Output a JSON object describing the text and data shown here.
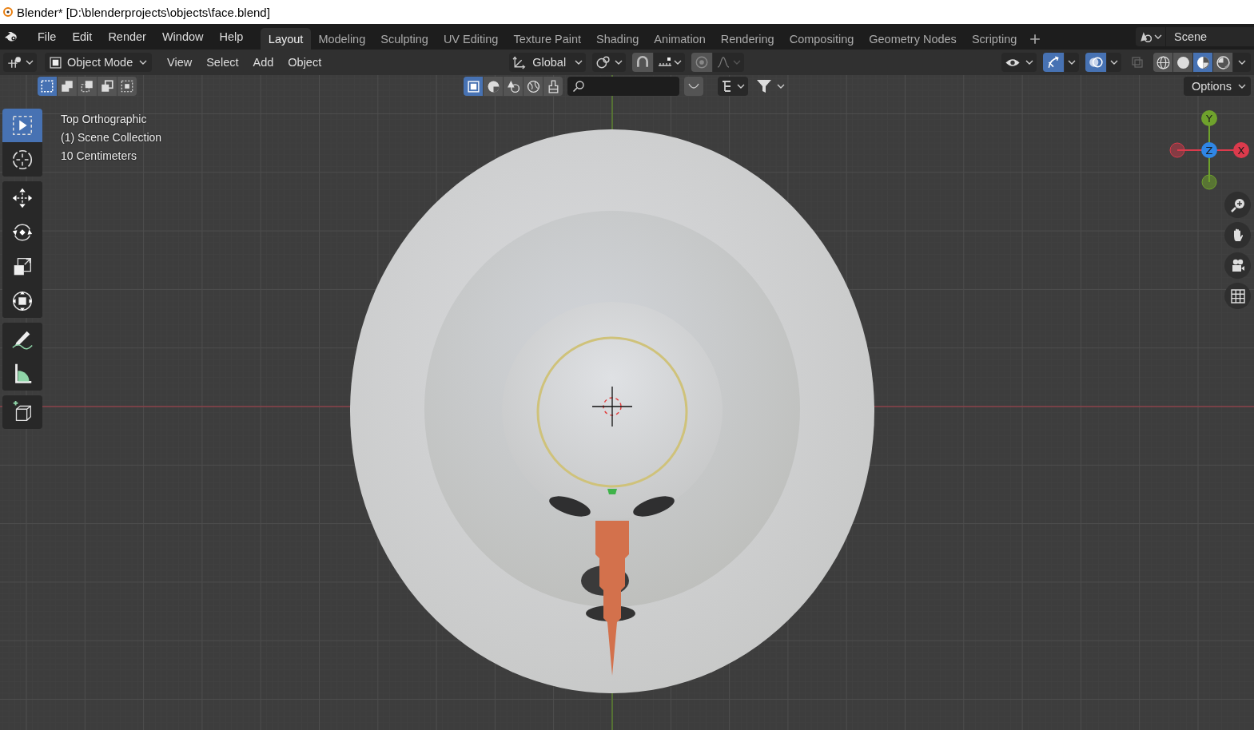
{
  "window": {
    "title": "Blender* [D:\\blenderprojects\\objects\\face.blend]"
  },
  "menu": [
    "File",
    "Edit",
    "Render",
    "Window",
    "Help"
  ],
  "workspaces": [
    {
      "label": "Layout",
      "selected": true
    },
    {
      "label": "Modeling",
      "selected": false
    },
    {
      "label": "Sculpting",
      "selected": false
    },
    {
      "label": "UV Editing",
      "selected": false
    },
    {
      "label": "Texture Paint",
      "selected": false
    },
    {
      "label": "Shading",
      "selected": false
    },
    {
      "label": "Animation",
      "selected": false
    },
    {
      "label": "Rendering",
      "selected": false
    },
    {
      "label": "Compositing",
      "selected": false
    },
    {
      "label": "Geometry Nodes",
      "selected": false
    },
    {
      "label": "Scripting",
      "selected": false
    }
  ],
  "scene": {
    "label": "Scene"
  },
  "header": {
    "mode": "Object Mode",
    "menus": [
      "View",
      "Select",
      "Add",
      "Object"
    ],
    "orientation": "Global"
  },
  "snap": {
    "on": false
  },
  "proportional_editing": {
    "on": false
  },
  "gizmos": {
    "on": true
  },
  "overlays": {
    "on": true
  },
  "xray": {
    "on": false
  },
  "shading_modes": [
    {
      "kind": "wireframe",
      "selected": false
    },
    {
      "kind": "solid",
      "selected": false
    },
    {
      "kind": "material",
      "selected": true
    },
    {
      "kind": "rendered",
      "selected": false
    }
  ],
  "select_modes": [
    {
      "kind": "set",
      "selected": true
    },
    {
      "kind": "extend",
      "selected": false
    },
    {
      "kind": "subtract",
      "selected": false
    },
    {
      "kind": "invert",
      "selected": false
    },
    {
      "kind": "intersect",
      "selected": false
    }
  ],
  "selectability": [
    {
      "kind": "mesh",
      "selected": true
    },
    {
      "kind": "solid",
      "selected": false
    },
    {
      "kind": "material",
      "selected": false
    },
    {
      "kind": "world",
      "selected": false
    },
    {
      "kind": "brush",
      "selected": false
    }
  ],
  "options": "Options",
  "viewport_info": [
    "Top Orthographic",
    "(1) Scene Collection",
    "10 Centimeters"
  ],
  "tool_groups": [
    {
      "tools": [
        {
          "kind": "select",
          "selected": true
        },
        {
          "kind": "cursor",
          "selected": false
        }
      ]
    },
    {
      "tools": [
        {
          "kind": "move",
          "selected": false
        },
        {
          "kind": "rotate",
          "selected": false
        },
        {
          "kind": "scale",
          "selected": false
        },
        {
          "kind": "transform",
          "selected": false
        }
      ]
    },
    {
      "tools": [
        {
          "kind": "annotate",
          "selected": false
        },
        {
          "kind": "measure",
          "selected": false
        }
      ]
    },
    {
      "tools": [
        {
          "kind": "add-cube",
          "selected": false
        }
      ]
    }
  ],
  "axes": [
    {
      "label": "Y",
      "color": "#6fa22c"
    },
    {
      "label": "Z",
      "color": "#2f86e5"
    },
    {
      "label": "X",
      "color": "#dc3a4c"
    }
  ]
}
